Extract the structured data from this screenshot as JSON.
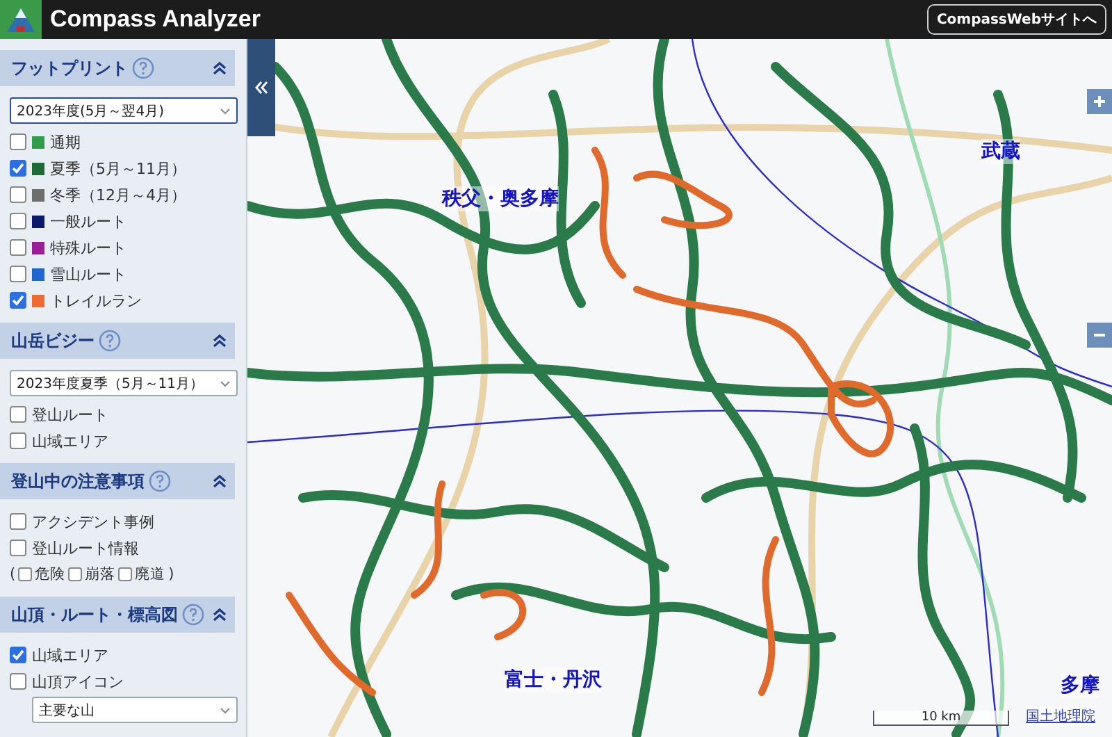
{
  "header": {
    "title": "Compass Analyzer",
    "site_button": "CompassWebサイトへ"
  },
  "sidebar": {
    "sections": [
      {
        "title": "フットプリント",
        "expanded": true,
        "items": [
          {
            "kind": "select",
            "value": "2023年度(5月～翌4月)",
            "focused": true
          },
          {
            "kind": "checkbox",
            "label": "通期",
            "checked": false,
            "color": "#2e9e4a"
          },
          {
            "kind": "checkbox",
            "label": "夏季（5月～11月）",
            "checked": true,
            "color": "#1e6b35"
          },
          {
            "kind": "checkbox",
            "label": "冬季（12月～4月）",
            "checked": false,
            "color": "#6e6e6e"
          },
          {
            "kind": "checkbox",
            "label": "一般ルート",
            "checked": false,
            "color": "#0c1a6e"
          },
          {
            "kind": "checkbox",
            "label": "特殊ルート",
            "checked": false,
            "color": "#9a1d9a"
          },
          {
            "kind": "checkbox",
            "label": "雪山ルート",
            "checked": false,
            "color": "#1e66d0"
          },
          {
            "kind": "checkbox",
            "label": "トレイルラン",
            "checked": true,
            "color": "#f06a30"
          }
        ]
      },
      {
        "title": "山岳ビジー",
        "expanded": true,
        "items": [
          {
            "kind": "select",
            "value": "2023年度夏季（5月～11月）",
            "focused": false
          },
          {
            "kind": "checkbox",
            "label": "登山ルート",
            "checked": false
          },
          {
            "kind": "checkbox",
            "label": "山域エリア",
            "checked": false
          }
        ]
      },
      {
        "title": "登山中の注意事項",
        "expanded": true,
        "items": [
          {
            "kind": "checkbox",
            "label": "アクシデント事例",
            "checked": false
          },
          {
            "kind": "checkbox",
            "label": "登山ルート情報",
            "checked": false
          },
          {
            "kind": "inline_checks",
            "open": "(",
            "close": ")",
            "options": [
              {
                "label": "危険",
                "checked": false
              },
              {
                "label": "崩落",
                "checked": false
              },
              {
                "label": "廃道",
                "checked": false
              }
            ]
          }
        ]
      },
      {
        "title": "山頂・ルート・標高図",
        "expanded": true,
        "items": [
          {
            "kind": "checkbox",
            "label": "山域エリア",
            "checked": true
          },
          {
            "kind": "checkbox",
            "label": "山頂アイコン",
            "checked": false
          },
          {
            "kind": "subselect",
            "value": "主要な山"
          }
        ]
      }
    ]
  },
  "map": {
    "labels": [
      "秩父・奥多摩",
      "武蔵",
      "富士・丹沢",
      "多摩"
    ],
    "scale": "10 km",
    "attribution": "国土地理院"
  }
}
